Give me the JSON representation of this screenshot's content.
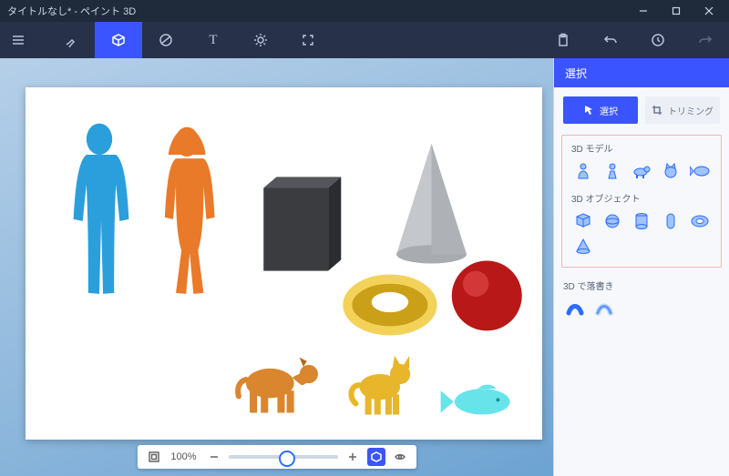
{
  "window": {
    "title": "タイトルなし* - ペイント 3D",
    "controls": {
      "minimize": "minimize",
      "maximize": "maximize",
      "close": "close"
    }
  },
  "toolbar": {
    "menu": "menu",
    "tools": [
      {
        "name": "brushes-tool",
        "icon": "brush-icon"
      },
      {
        "name": "3d-shapes-tool",
        "icon": "cube-icon",
        "active": true
      },
      {
        "name": "stickers-tool",
        "icon": "circle-cross-icon"
      },
      {
        "name": "text-tool",
        "icon": "text-icon",
        "glyph": "T"
      },
      {
        "name": "effects-tool",
        "icon": "sun-icon"
      },
      {
        "name": "canvas-tool",
        "icon": "expand-icon"
      }
    ],
    "right": [
      {
        "name": "paste-tool",
        "icon": "clipboard-icon"
      },
      {
        "name": "undo-tool",
        "icon": "undo-icon"
      },
      {
        "name": "history-tool",
        "icon": "history-icon"
      },
      {
        "name": "redo-tool",
        "icon": "redo-icon"
      }
    ]
  },
  "zoom": {
    "fit_label": "fit",
    "value": "100%",
    "minus": "−",
    "plus": "＋"
  },
  "panel": {
    "header": "選択",
    "tabs": {
      "select": {
        "label": "選択",
        "icon": "cursor-icon"
      },
      "crop": {
        "label": "トリミング",
        "icon": "crop-icon"
      }
    },
    "section_models": {
      "title": "3D モデル",
      "items": [
        "man",
        "woman",
        "dog",
        "cat",
        "fish"
      ]
    },
    "section_objects": {
      "title": "3D オブジェクト",
      "items": [
        "cube",
        "sphere",
        "cylinder",
        "capsule",
        "torus",
        "cone"
      ]
    },
    "section_doodle": {
      "title": "3D で落書き",
      "items": [
        "tube-brush",
        "sharp-brush"
      ]
    }
  },
  "canvas": {
    "objects": [
      "man-blue",
      "woman-orange",
      "cube-dark",
      "cone-grey",
      "torus-gold",
      "sphere-red",
      "dog-orange",
      "cat-gold",
      "fish-cyan"
    ]
  },
  "colors": {
    "accent": "#3a55ff",
    "toolbar": "#27324a",
    "titlebar": "#1f2a3a"
  }
}
